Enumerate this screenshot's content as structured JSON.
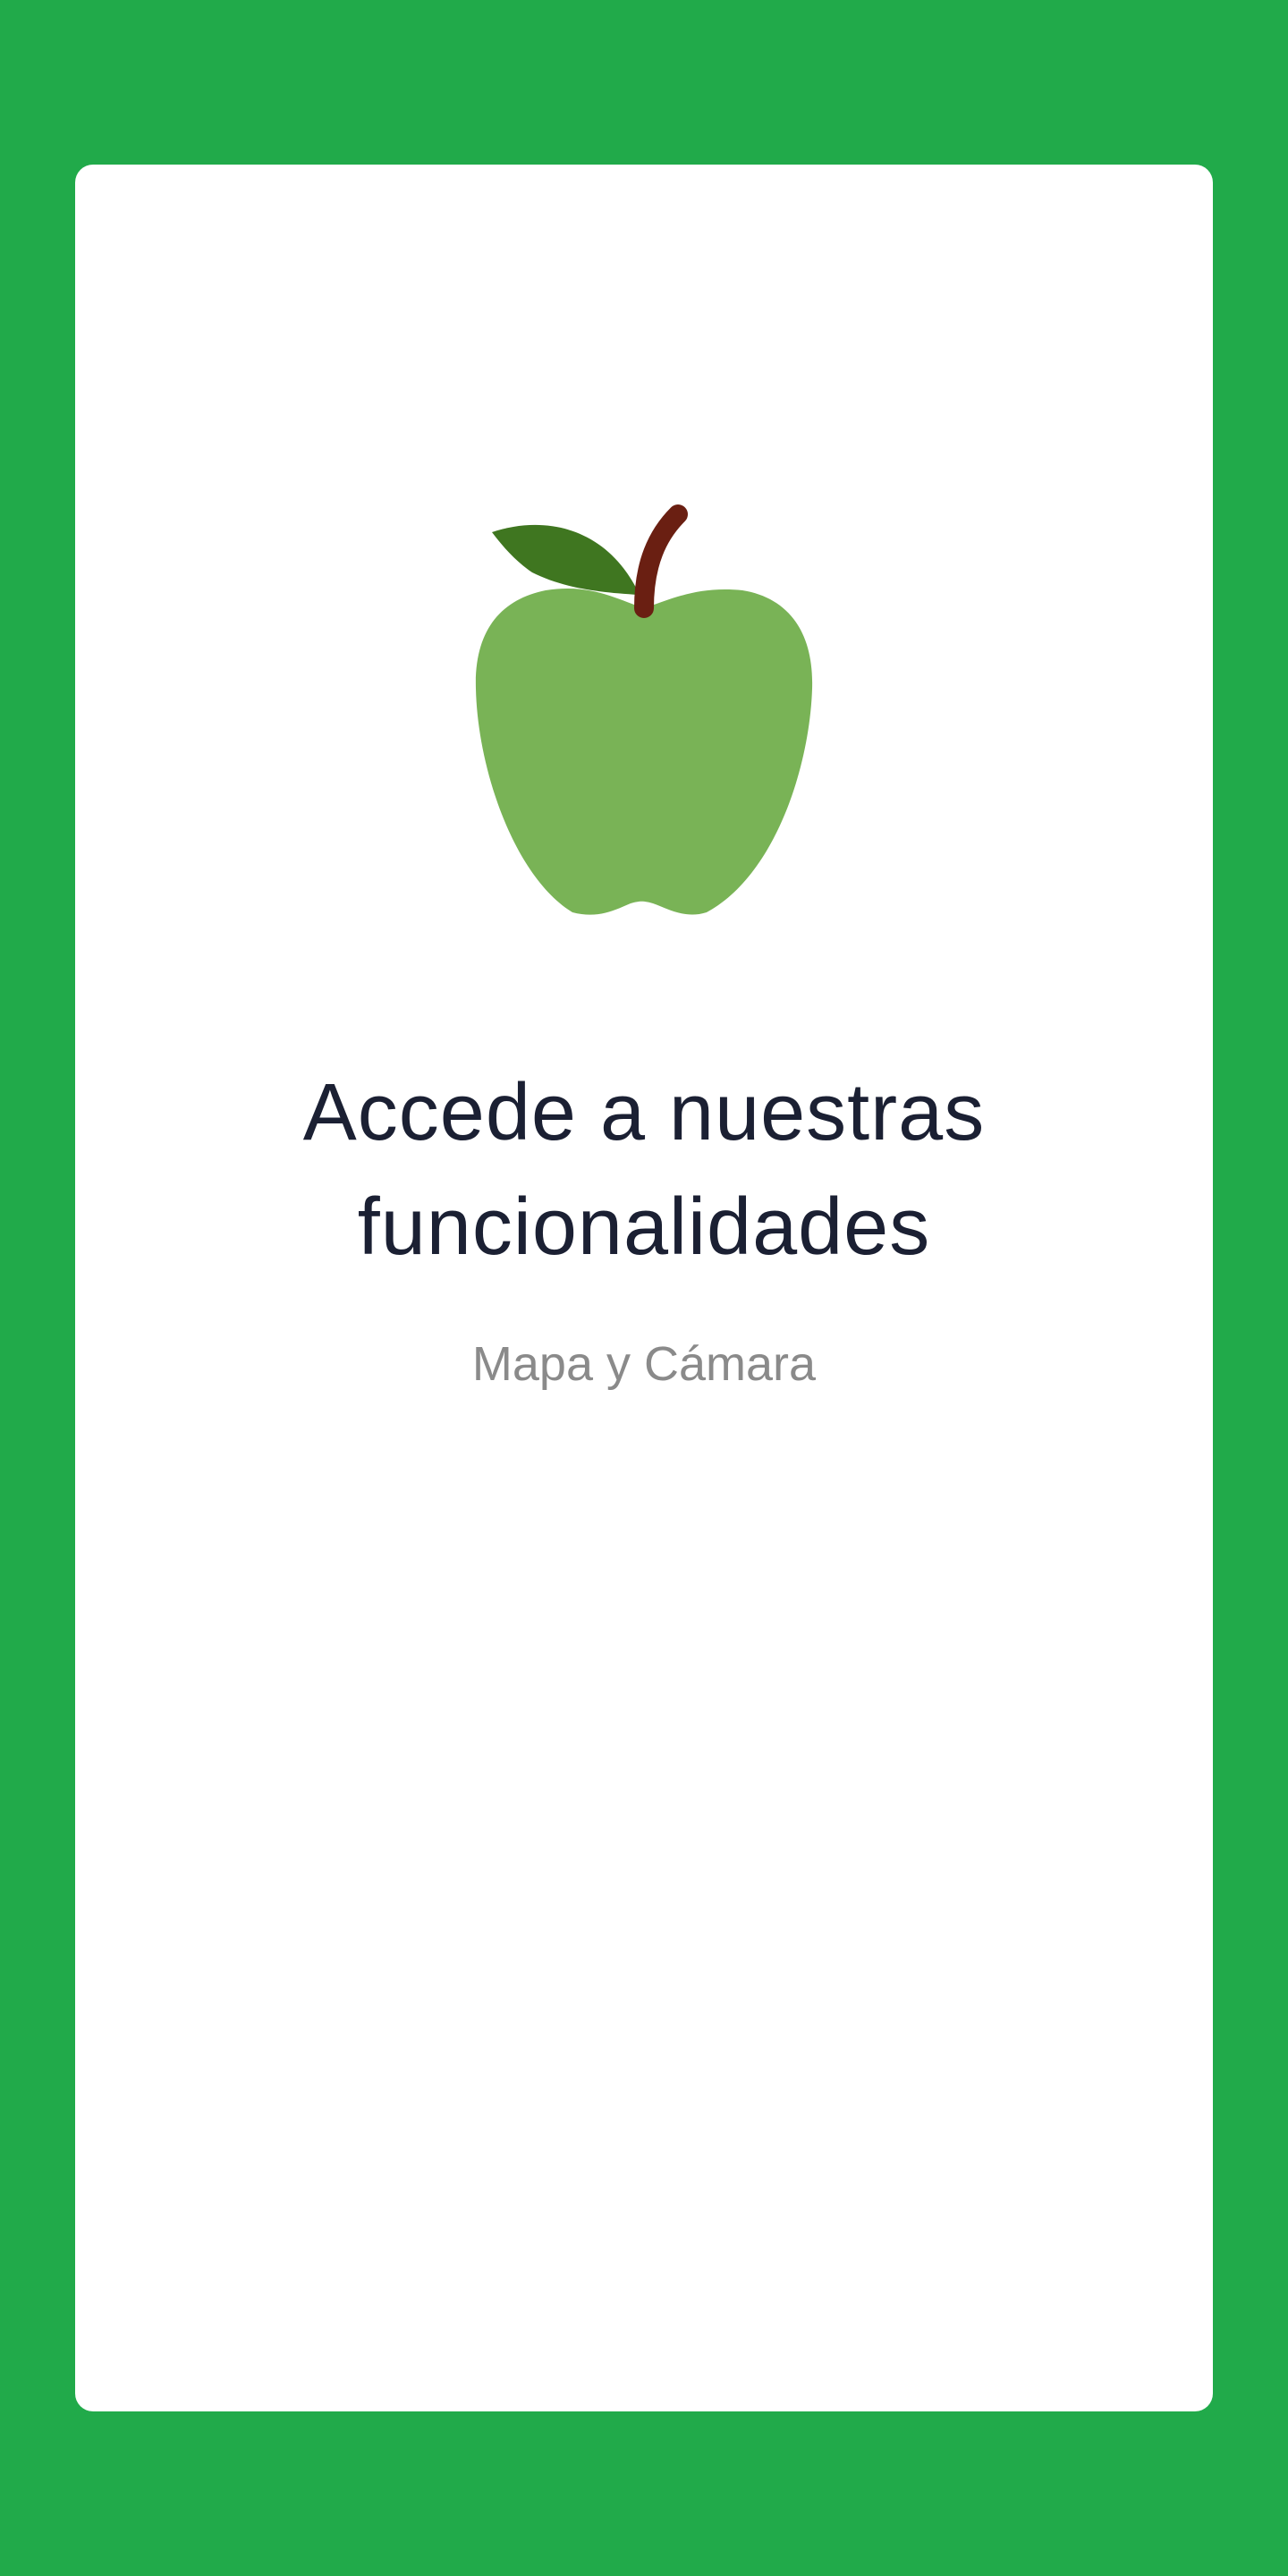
{
  "screen": {
    "background_color": "#21aa4a",
    "card_color": "#ffffff"
  },
  "illustration": {
    "icon": "green-apple-icon",
    "body_color": "#79b356",
    "leaf_color": "#3f7620",
    "stem_color": "#6a1f12"
  },
  "content": {
    "title_line_1": "Accede a nuestras",
    "title_line_2": "funcionalidades",
    "subtitle": "Mapa y Cámara"
  }
}
